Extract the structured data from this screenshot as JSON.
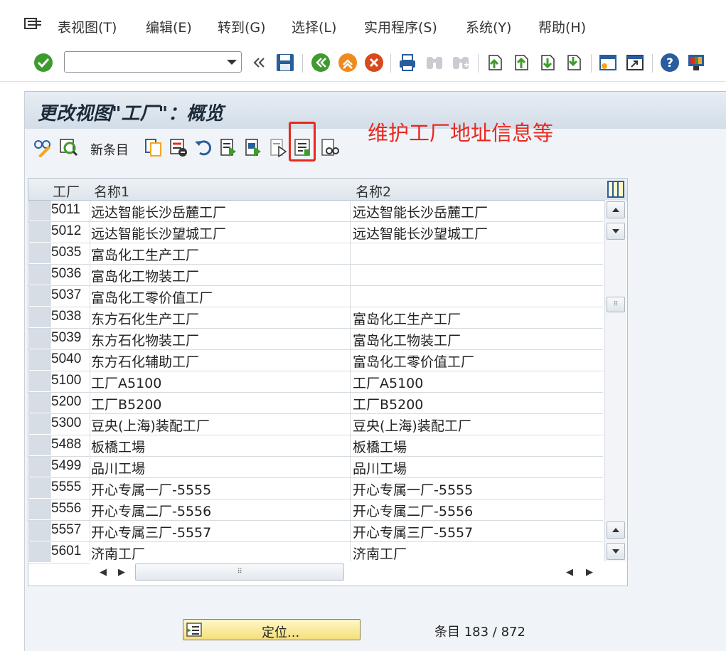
{
  "menu": {
    "items": [
      "表视图(T)",
      "编辑(E)",
      "转到(G)",
      "选择(L)",
      "实用程序(S)",
      "系统(Y)",
      "帮助(H)"
    ]
  },
  "toolbar": {
    "command_value": "",
    "icons": [
      "enter-icon",
      "back-double-chevron-icon",
      "save-icon",
      "back-icon",
      "exit-icon",
      "cancel-icon",
      "print-icon",
      "find-icon",
      "find-next-icon",
      "first-page-icon",
      "previous-page-icon",
      "next-page-icon",
      "last-page-icon",
      "create-session-icon",
      "shortcut-icon",
      "help-icon",
      "layout-menu-icon"
    ]
  },
  "page": {
    "title": "更改视图\"工厂\"：概览",
    "new_entries_label": "新条目",
    "annotation": "维护工厂地址信息等"
  },
  "table": {
    "columns": [
      "工厂",
      "名称1",
      "名称2"
    ],
    "rows": [
      {
        "plant": "5011",
        "name1": "远达智能长沙岳麓工厂",
        "name2": "远达智能长沙岳麓工厂"
      },
      {
        "plant": "5012",
        "name1": "远达智能长沙望城工厂",
        "name2": "远达智能长沙望城工厂"
      },
      {
        "plant": "5035",
        "name1": "富岛化工生产工厂",
        "name2": ""
      },
      {
        "plant": "5036",
        "name1": "富岛化工物装工厂",
        "name2": ""
      },
      {
        "plant": "5037",
        "name1": "富岛化工零价值工厂",
        "name2": ""
      },
      {
        "plant": "5038",
        "name1": "东方石化生产工厂",
        "name2": "富岛化工生产工厂"
      },
      {
        "plant": "5039",
        "name1": "东方石化物装工厂",
        "name2": "富岛化工物装工厂"
      },
      {
        "plant": "5040",
        "name1": "东方石化辅助工厂",
        "name2": "富岛化工零价值工厂"
      },
      {
        "plant": "5100",
        "name1": "工厂A5100",
        "name2": "工厂A5100"
      },
      {
        "plant": "5200",
        "name1": "工厂B5200",
        "name2": "工厂B5200"
      },
      {
        "plant": "5300",
        "name1": "豆央(上海)装配工厂",
        "name2": "豆央(上海)装配工厂"
      },
      {
        "plant": "5488",
        "name1": "板橋工場",
        "name2": "板橋工場"
      },
      {
        "plant": "5499",
        "name1": "品川工場",
        "name2": "品川工場"
      },
      {
        "plant": "5555",
        "name1": "开心专属一厂-5555",
        "name2": "开心专属一厂-5555"
      },
      {
        "plant": "5556",
        "name1": "开心专属二厂-5556",
        "name2": "开心专属二厂-5556"
      },
      {
        "plant": "5557",
        "name1": "开心专属三厂-5557",
        "name2": "开心专属三厂-5557"
      },
      {
        "plant": "5601",
        "name1": "济南工厂",
        "name2": "济南工厂"
      }
    ]
  },
  "footer": {
    "locate_label": "定位...",
    "entry_counter": "条目 183 / 872"
  },
  "colors": {
    "accent_green": "#3f9b2d",
    "annotation_red": "#e8281e",
    "button_yellow": "#f5df7a"
  }
}
